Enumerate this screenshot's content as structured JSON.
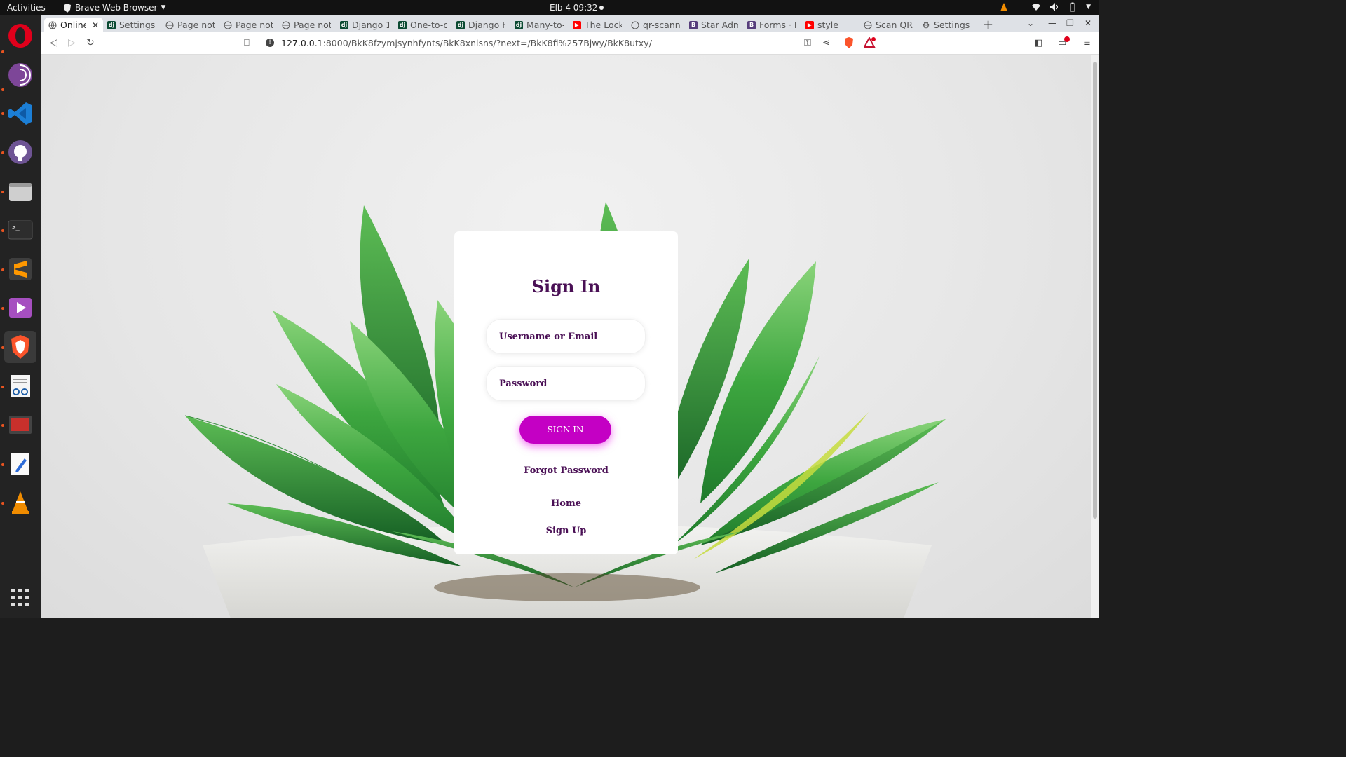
{
  "topbar": {
    "activities": "Activities",
    "app_name": "Brave Web Browser",
    "clock": "Elb 4  09:32"
  },
  "dock": {
    "apps": [
      "opera",
      "tor-browser",
      "vscode",
      "github-desktop",
      "files",
      "terminal",
      "sublime-text",
      "video-player",
      "brave",
      "document-viewer",
      "remote-desktop",
      "text-editor",
      "vlc",
      "show-apps"
    ]
  },
  "browser": {
    "tabs": [
      {
        "label": "Online",
        "icon": "globe-icon",
        "active": true
      },
      {
        "label": "Settings",
        "icon": "django-icon"
      },
      {
        "label": "Page not",
        "icon": "globe-icon"
      },
      {
        "label": "Page not",
        "icon": "globe-icon"
      },
      {
        "label": "Page not",
        "icon": "globe-icon"
      },
      {
        "label": "Django 1.",
        "icon": "django-icon"
      },
      {
        "label": "One-to-o",
        "icon": "django-icon"
      },
      {
        "label": "Django F",
        "icon": "django-icon"
      },
      {
        "label": "Many-to-",
        "icon": "django-icon"
      },
      {
        "label": "The Lock",
        "icon": "youtube-icon"
      },
      {
        "label": "qr-scann",
        "icon": "github-icon"
      },
      {
        "label": "Star Adm",
        "icon": "bootstrap-icon"
      },
      {
        "label": "Forms · B",
        "icon": "bootstrap-icon"
      },
      {
        "label": "style",
        "icon": "youtube-icon"
      },
      {
        "label": "Scan QR",
        "icon": "globe-icon"
      },
      {
        "label": "Settings",
        "icon": "gear-icon"
      }
    ],
    "url_host": "127.0.0.1",
    "url_path": ":8000/BkK8fzymjsynhfynts/BkK8xnlsns/?next=/BkK8fi%257Bjwy/BkK8utxy/",
    "colors": {
      "brand_accent": "#c400c4",
      "text_purple": "#4a1055"
    }
  },
  "signin": {
    "title": "Sign In",
    "username_placeholder": "Username or Email",
    "password_placeholder": "Password",
    "submit_label": "SIGN IN",
    "forgot_label": "Forgot Password",
    "home_label": "Home",
    "signup_label": "Sign Up"
  }
}
